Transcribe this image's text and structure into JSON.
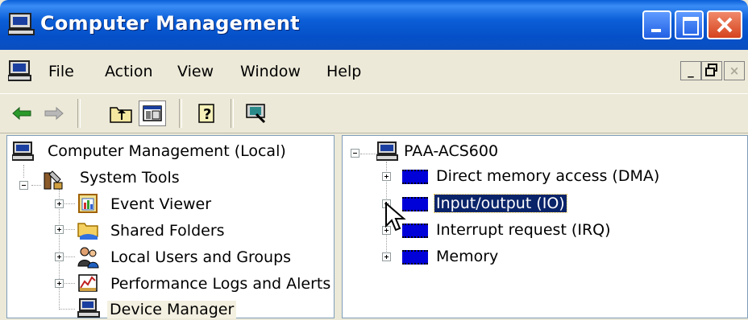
{
  "window": {
    "title": "Computer Management"
  },
  "menu": {
    "items": [
      "File",
      "Action",
      "View",
      "Window",
      "Help"
    ]
  },
  "mdi_controls": {
    "minimize": "_",
    "restore": "🗗",
    "close": "×"
  },
  "toolbar": {
    "buttons": [
      "back-icon",
      "forward-icon",
      "up-folder-icon",
      "show-hide-tree-icon",
      "help-icon",
      "properties-icon"
    ]
  },
  "left_tree": {
    "root": "Computer Management (Local)",
    "system_tools": "System Tools",
    "children": [
      "Event Viewer",
      "Shared Folders",
      "Local Users and Groups",
      "Performance Logs and Alerts",
      "Device Manager"
    ]
  },
  "right_tree": {
    "root": "PAA-ACS600",
    "children": [
      "Direct memory access (DMA)",
      "Input/output (IO)",
      "Interrupt request (IRQ)",
      "Memory"
    ],
    "selected_index": 1
  },
  "colors": {
    "titlebar": "#0b5ed7",
    "selection": "#0a246a",
    "chip": "#0000d8"
  }
}
